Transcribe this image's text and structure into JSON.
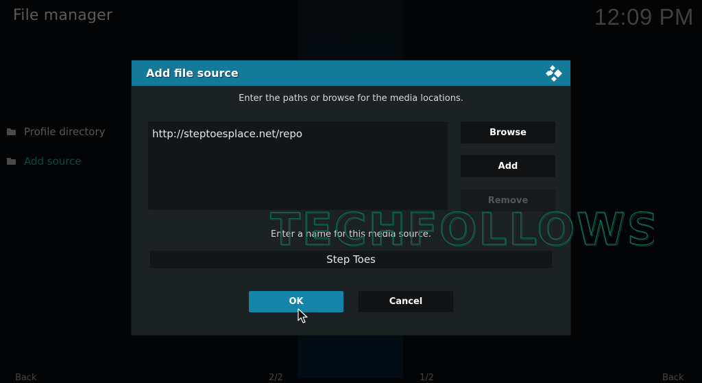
{
  "app": {
    "title": "File manager",
    "clock": "12:09 PM"
  },
  "sidebar": {
    "items": [
      {
        "label": "Profile directory",
        "icon": "folder-icon"
      },
      {
        "label": "Add source",
        "icon": "folder-icon"
      }
    ]
  },
  "footer": {
    "left": "Back",
    "center_left": "2/2",
    "center_right": "1/2",
    "right": "Back"
  },
  "dialog": {
    "title": "Add file source",
    "logo_icon": "kodi-logo-icon",
    "subtitle": "Enter the paths or browse for the media locations.",
    "paths": [
      "http://steptoesplace.net/repo"
    ],
    "buttons": {
      "browse": "Browse",
      "add": "Add",
      "remove": "Remove"
    },
    "name_label": "Enter a name for this media source.",
    "name_value": "Step Toes",
    "ok": "OK",
    "cancel": "Cancel"
  },
  "watermark": "TECHFOLLOWS",
  "colors": {
    "accent": "#147a99",
    "button_focus": "#1484a8",
    "dialog_bg": "#1c2124",
    "watermark": "#0e6b55"
  }
}
